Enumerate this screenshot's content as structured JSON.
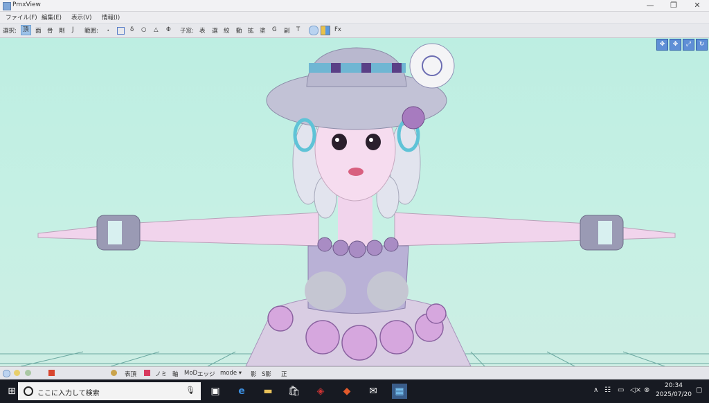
{
  "window": {
    "title": "PmxView",
    "minimize": "—",
    "restore": "❐",
    "close": "✕"
  },
  "menu": [
    "ファイル(F)",
    "編集(E)",
    "表示(V)",
    "情報(I)"
  ],
  "toolbar": {
    "select_label": "選択:",
    "select_items": [
      "頂",
      "面",
      "骨",
      "剛",
      "J"
    ],
    "range_label": "範囲:",
    "range_items": [
      "・",
      "δ",
      "○",
      "△",
      "Φ"
    ],
    "child_label": "子窓:",
    "child_items": [
      "表",
      "選",
      "絞",
      "動",
      "拡",
      "塗",
      "G",
      "副",
      "T"
    ],
    "fx": "Fx"
  },
  "viewport": {
    "background": "#c4efe3"
  },
  "bottombar": {
    "items": [
      "表頂",
      "ノミ",
      "軸",
      "MoD",
      "エッジ",
      "mode ▾",
      "影",
      "S影",
      "正"
    ]
  },
  "taskbar": {
    "search_placeholder": "ここに入力して検索",
    "time": "20:34",
    "date": "2025/07/20"
  }
}
